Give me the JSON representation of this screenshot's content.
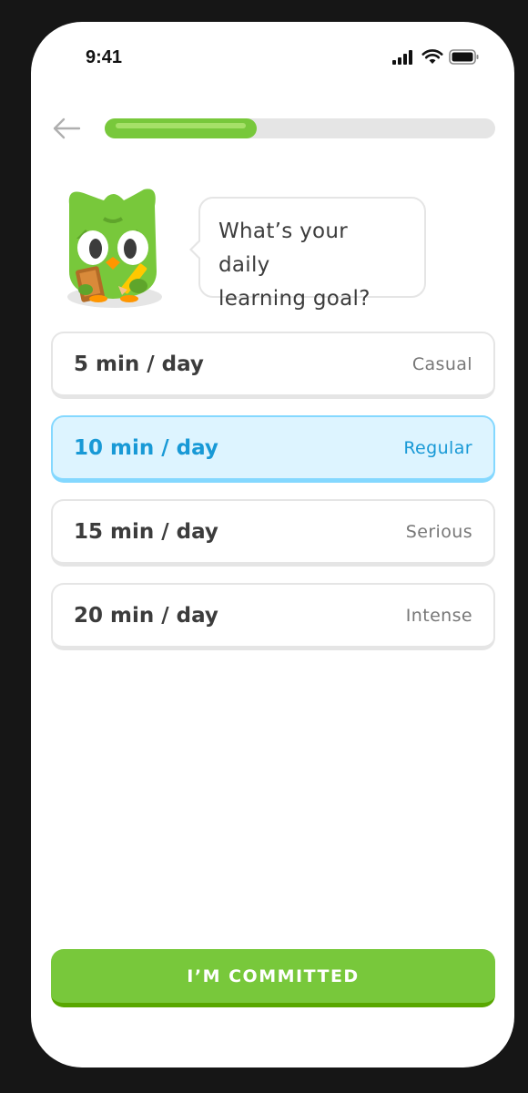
{
  "status_bar": {
    "time": "9:41",
    "icons": [
      "signal-icon",
      "wifi-icon",
      "battery-icon"
    ]
  },
  "header": {
    "back_icon": "arrow-left-icon",
    "progress": 0.39
  },
  "prompt": {
    "line1": "What’s your daily",
    "line2": "learning goal?"
  },
  "options": [
    {
      "time": "5 min / day",
      "level": "Casual",
      "selected": false
    },
    {
      "time": "10 min / day",
      "level": "Regular",
      "selected": true
    },
    {
      "time": "15 min / day",
      "level": "Serious",
      "selected": false
    },
    {
      "time": "20 min / day",
      "level": "Intense",
      "selected": false
    }
  ],
  "footer": {
    "commit_label": "I’M COMMITTED"
  },
  "colors": {
    "brand_green": "#78c83b",
    "selected_blue": "#1899d6",
    "selected_bg": "#ddf4ff",
    "selected_border": "#84d8ff"
  }
}
